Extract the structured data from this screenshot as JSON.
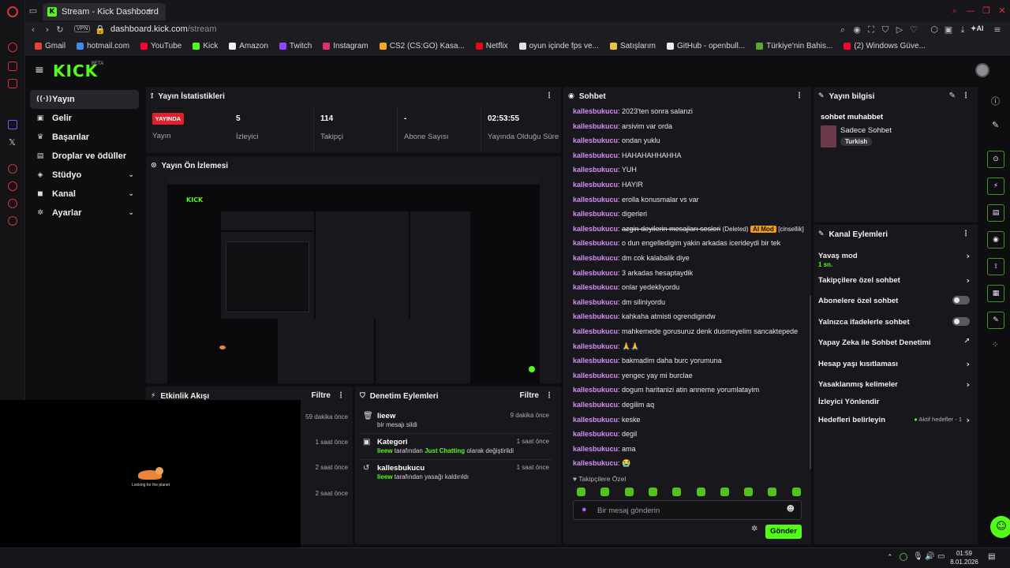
{
  "browser": {
    "tab_title": "Stream - Kick Dashboard",
    "new_tab": "+",
    "url_host": "dashboard.kick.com",
    "url_path": "/stream",
    "vpn_label": "VPN",
    "ai_label": "AI",
    "bookmarks": [
      {
        "label": "Gmail",
        "color": "#ea4335"
      },
      {
        "label": "hotmail.com",
        "color": "#3c8cf0"
      },
      {
        "label": "YouTube",
        "color": "#ff0033"
      },
      {
        "label": "Kick",
        "color": "#53fc18"
      },
      {
        "label": "Amazon",
        "color": "#f2f2f2"
      },
      {
        "label": "Twitch",
        "color": "#9146ff"
      },
      {
        "label": "Instagram",
        "color": "#e1306c"
      },
      {
        "label": "CS2 (CS:GO) Kasa...",
        "color": "#f5a623"
      },
      {
        "label": "Netflix",
        "color": "#e50914"
      },
      {
        "label": "oyun içinde fps ve...",
        "color": "#e0e0e0"
      },
      {
        "label": "Satışlarım",
        "color": "#f0c040"
      },
      {
        "label": "GitHub - openbull...",
        "color": "#eeeeee"
      },
      {
        "label": "Türkiye'nin Bahis...",
        "color": "#5aa832"
      },
      {
        "label": "(2) Windows Güve...",
        "color": "#ff0033"
      }
    ]
  },
  "header": {
    "logo": "KICK",
    "beta": "BETA"
  },
  "sidebar": {
    "items": [
      {
        "label": "Yayın",
        "icon": "broadcast-icon",
        "glyph": "((·))"
      },
      {
        "label": "Gelir",
        "icon": "wallet-icon",
        "glyph": "▣"
      },
      {
        "label": "Başarılar",
        "icon": "trophy-icon",
        "glyph": "♛"
      },
      {
        "label": "Droplar ve ödüller",
        "icon": "gift-icon",
        "glyph": "▤"
      },
      {
        "label": "Stüdyo",
        "icon": "studio-icon",
        "glyph": "◈",
        "chevron": "⌄"
      },
      {
        "label": "Kanal",
        "icon": "channel-icon",
        "glyph": "◼",
        "chevron": "⌄"
      },
      {
        "label": "Ayarlar",
        "icon": "gear-icon",
        "glyph": "✲",
        "chevron": "⌄"
      }
    ]
  },
  "stats": {
    "title": "Yayın İstatistikleri",
    "live_badge": "YAYINDA",
    "live_label": "Yayın",
    "viewers": "5",
    "viewers_label": "İzleyici",
    "followers": "114",
    "followers_label": "Takipçi",
    "subs": "-",
    "subs_label": "Abone Sayısı",
    "uptime": "02:53:55",
    "uptime_label": "Yayında Olduğu Süre"
  },
  "preview": {
    "title": "Yayın Ön İzlemesi",
    "overlay_text": "Looking for the planet"
  },
  "activity": {
    "title": "Etkinlik Akışı",
    "filter": "Filtre",
    "times": [
      "59 dakika önce",
      "1 saat önce",
      "2 saat önce",
      "2 saat önce"
    ]
  },
  "moderation": {
    "title": "Denetim Eylemleri",
    "filter": "Filtre",
    "items": [
      {
        "title": "lieew",
        "time": "9 dakika önce",
        "desc_plain": "bir mesajı sildi"
      },
      {
        "title": "Kategori",
        "time": "1 saat önce",
        "actor": "lieew",
        "mid": " tarafından ",
        "cat": "Just Chatting",
        "tail": " olarak değiştirildi"
      },
      {
        "title": "kallesbukucu",
        "time": "1 saat önce",
        "actor": "lieew",
        "mid": " tarafından yasağı kaldırıldı"
      }
    ]
  },
  "chat": {
    "title": "Sohbet",
    "username": "kallesbukucu",
    "messages": [
      "2023'ten sonra salanzi",
      "arsivim var orda",
      "ondan yuklu",
      "HAHAHAHHAHHA",
      "YUH",
      "HAYIR",
      "erolla konusmalar vs var",
      "digerleri",
      "",
      "o dun engelledigim yakin arkadas icerideydi bir tek",
      "dm cok kalabalik diye",
      "3 arkadas hesaptaydik",
      "onlar yedekliyordu",
      "dm siliniyordu",
      "kahkaha atmisti ogrendigindw",
      "mahkemede gorusuruz denk dusmeyelim sancaktepede",
      "🙏🙏",
      "bakmadim daha burc yorumuna",
      "yengec yay mi burclae",
      "dogum haritanizi atin anneme yorumlatayim",
      "degilim aq",
      "keske",
      "degil",
      "ama",
      "😭"
    ],
    "deleted_message": "azgin deyilerin mesajları sesleri",
    "deleted_tag": "(Deleted)",
    "ai_mod": "AI Mod",
    "reason": "[cinsellik]",
    "followers_only": "Takipçilere Özel",
    "placeholder": "Bir mesaj gönderin",
    "send": "Gönder"
  },
  "stream_info": {
    "title": "Yayın bilgisi",
    "stream_title": "sohbet muhabbet",
    "category": "Sadece Sohbet",
    "tag": "Turkish"
  },
  "channel_actions": {
    "title": "Kanal Eylemleri",
    "slow_mode": "Yavaş mod",
    "slow_value": "1 sn.",
    "followers_chat": "Takipçilere özel sohbet",
    "subs_chat": "Abonelere özel sohbet",
    "emotes_chat": "Yalnızca ifadelerle sohbet",
    "ai_moderation": "Yapay Zeka ile Sohbet Denetimi",
    "age_restrict": "Hesap yaşı kısıtlaması",
    "banned_words": "Yasaklanmış kelimeler",
    "viewer_redirect": "İzleyici Yönlendir",
    "goals": "Hedefleri belirleyin",
    "active_goals": "Aktif hedefler - 1"
  },
  "taskbar": {
    "time": "01:59",
    "date": "8.01.2026"
  },
  "colors": {
    "accent": "#53fc18",
    "live": "#e0212c",
    "username": "#d68ef5",
    "panel": "#18181c"
  }
}
